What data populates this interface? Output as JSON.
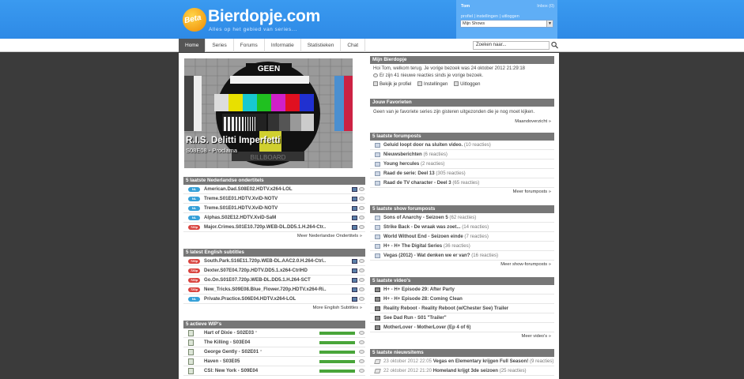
{
  "header": {
    "logo_badge": "Beta",
    "logo_name": "Bierdopje.com",
    "tagline": "Alles op het gebied van series...",
    "username": "Tom",
    "inbox": "Inbox (0)",
    "user_links": "profiel | instellingen | uitloggen",
    "shows_select": "Mijn Shows"
  },
  "nav": {
    "tabs": [
      "Home",
      "Series",
      "Forums",
      "Informatie",
      "Statistieken",
      "Chat"
    ],
    "search_placeholder": "Zoeken naar..."
  },
  "feature": {
    "title": "R.I.S. Delitti Imperfetti",
    "subtitle": "S08E08 - Proclama",
    "testcard_label": "GEEN",
    "testcard_bottom": "BILLBOARD"
  },
  "nl_subs": {
    "title": "5 laatste Nederlandse ondertitels",
    "items": [
      {
        "lang": "NL",
        "label": "American.Dad.S08E02.HDTV.x264-LOL"
      },
      {
        "lang": "NL",
        "label": "Treme.S01E01.HDTV.XviD-NOTV"
      },
      {
        "lang": "NL",
        "label": "Treme.S01E01.HDTV.XviD-NOTV"
      },
      {
        "lang": "NL",
        "label": "Alphas.S02E12.HDTV.XviD-SaM"
      },
      {
        "lang": "720p",
        "label": "Major.Crimes.S01E10.720p.WEB-DL.DD5.1.H.264-Ctr.."
      }
    ],
    "more": "Meer Nederlandse Ondertitels »"
  },
  "en_subs": {
    "title": "5 latest English subtitles",
    "items": [
      {
        "lang": "720p",
        "label": "South.Park.S16E11.720p.WEB-DL.AAC2.0.H.264-Ctrl.."
      },
      {
        "lang": "720p",
        "label": "Dexter.S07E04.720p.HDTV.DD5.1.x264-CtrlHD"
      },
      {
        "lang": "720p",
        "label": "Go.On.S01E07.720p.WEB-DL.DD5.1.H.264-SCT"
      },
      {
        "lang": "720p",
        "label": "New_Tricks.S09E08.Blue_Flower.720p.HDTV.x264-Ri.."
      },
      {
        "lang": "NL",
        "label": "Private.Practice.S06E04.HDTV.x264-LOL"
      }
    ],
    "more": "More English Subtitles »"
  },
  "wip": {
    "title": "5 actieve WIP's",
    "items": [
      {
        "label": "Hart of Dixie - S02E03",
        "star": "*",
        "progress": 1.0
      },
      {
        "label": "The Killing - S03E04",
        "star": "",
        "progress": 1.0
      },
      {
        "label": "George Gently - S02E01",
        "star": "*",
        "progress": 1.0
      },
      {
        "label": "Haven - S03E05",
        "star": "",
        "progress": 1.0
      },
      {
        "label": "CSI: New York - S09E04",
        "star": "",
        "progress": 1.0
      }
    ]
  },
  "mijn": {
    "title": "Mijn Bierdopje",
    "welcome": "Hoi Tom, welkom terug. Je vorige bezoek was 24 oktober 2012 21:29:18",
    "reactions": "Er zijn 41 nieuwe reacties sinds je vorige bezoek.",
    "profile_link": "Bekijk je profiel",
    "settings_link": "Instellingen",
    "logout_link": "Uitloggen"
  },
  "favorites": {
    "title": "Jouw Favorieten",
    "text": "Geen van je favoriete series zijn gisteren uitgezonden die je nog moet kijken.",
    "more": "Maandoverzicht »"
  },
  "forumposts": {
    "title": "5 laatste forumposts",
    "items": [
      {
        "label": "Geluid loopt door na sluiten video.",
        "extra": "(10 reacties)"
      },
      {
        "label": "Nieuwsberichten",
        "extra": "(6 reacties)"
      },
      {
        "label": "Young hercules",
        "extra": "(2 reacties)"
      },
      {
        "label": "Raad de serie: Deel 13",
        "extra": "(305 reacties)"
      },
      {
        "label": "Raad de TV character - Deel 3",
        "extra": "(65 reacties)"
      }
    ],
    "more": "Meer forumposts »"
  },
  "showposts": {
    "title": "5 laatste show forumposts",
    "items": [
      {
        "label": "Sons of Anarchy - Seizoen 5",
        "extra": "(62 reacties)"
      },
      {
        "label": "Strike Back - De wraak was zoet...",
        "extra": "(14 reacties)"
      },
      {
        "label": "World Without End - Seizoen einde",
        "extra": "(7 reacties)"
      },
      {
        "label": "H+ - H+ The Digital Series",
        "extra": "(36 reacties)"
      },
      {
        "label": "Vegas (2012) - Wat denken we er van?",
        "extra": "(16 reacties)"
      }
    ],
    "more": "Meer show-forumposts »"
  },
  "videos": {
    "title": "5 laatste video's",
    "items": [
      {
        "label": "H+ - H+ Episode 29: After Party"
      },
      {
        "label": "H+ - H+ Episode 28: Coming Clean"
      },
      {
        "label": "Reality Reboot - Reality Reboot (w/Chester See) Trailer"
      },
      {
        "label": "See Dad Run - S01 \"Trailer\""
      },
      {
        "label": "MotherLover - MotherLover (Ep 4 of 6)"
      }
    ],
    "more": "Meer video's »"
  },
  "news": {
    "title": "5 laatste nieuwsitems",
    "items": [
      {
        "ts": "23 oktober 2012 22:05",
        "label": "Vegas en Elementary krijgen Full Season!",
        "extra": "(9 reacties)"
      },
      {
        "ts": "22 oktober 2012 21:20",
        "label": "Homeland krijgt 3de seizoen",
        "extra": "(25 reacties)"
      }
    ]
  }
}
